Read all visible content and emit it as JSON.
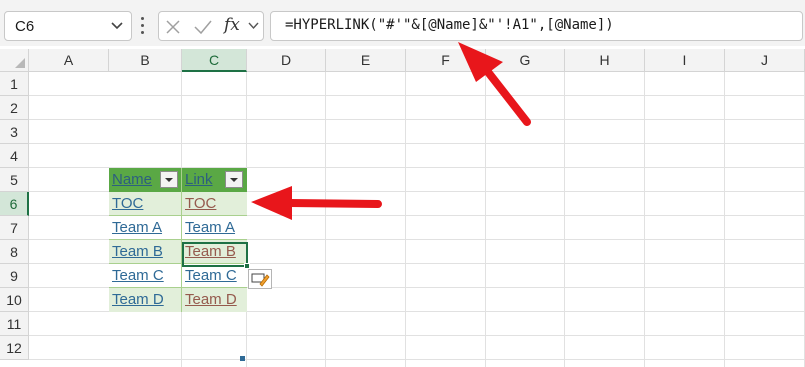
{
  "formula_bar": {
    "name_box": "C6",
    "fx": "fx",
    "formula": "=HYPERLINK(\"#'\"&[@Name]&\"'!A1\",[@Name])"
  },
  "columns": [
    "A",
    "B",
    "C",
    "D",
    "E",
    "F",
    "G",
    "H",
    "I",
    "J"
  ],
  "active_column": "C",
  "rows": [
    "1",
    "2",
    "3",
    "4",
    "5",
    "6",
    "7",
    "8",
    "9",
    "10",
    "11",
    "12"
  ],
  "active_row": "6",
  "table": {
    "headers": [
      "Name",
      "Link"
    ],
    "rows": [
      {
        "name": "TOC",
        "link": "TOC",
        "link_visited": true
      },
      {
        "name": "Team A",
        "link": "Team A",
        "link_visited": false
      },
      {
        "name": "Team B",
        "link": "Team B",
        "link_visited": true
      },
      {
        "name": "Team C",
        "link": "Team C",
        "link_visited": false
      },
      {
        "name": "Team D",
        "link": "Team D",
        "link_visited": true
      }
    ]
  },
  "colors": {
    "header_fill": "#5aa845",
    "band_fill": "#e2efda",
    "hyperlink": "#2f6a96",
    "visited_hyperlink": "#955a4d",
    "annotation_arrow": "#e8161b"
  },
  "icons": [
    "chevron-down-icon",
    "cancel-icon",
    "enter-icon",
    "filter-dropdown-icon",
    "autocorrect-options-icon"
  ]
}
